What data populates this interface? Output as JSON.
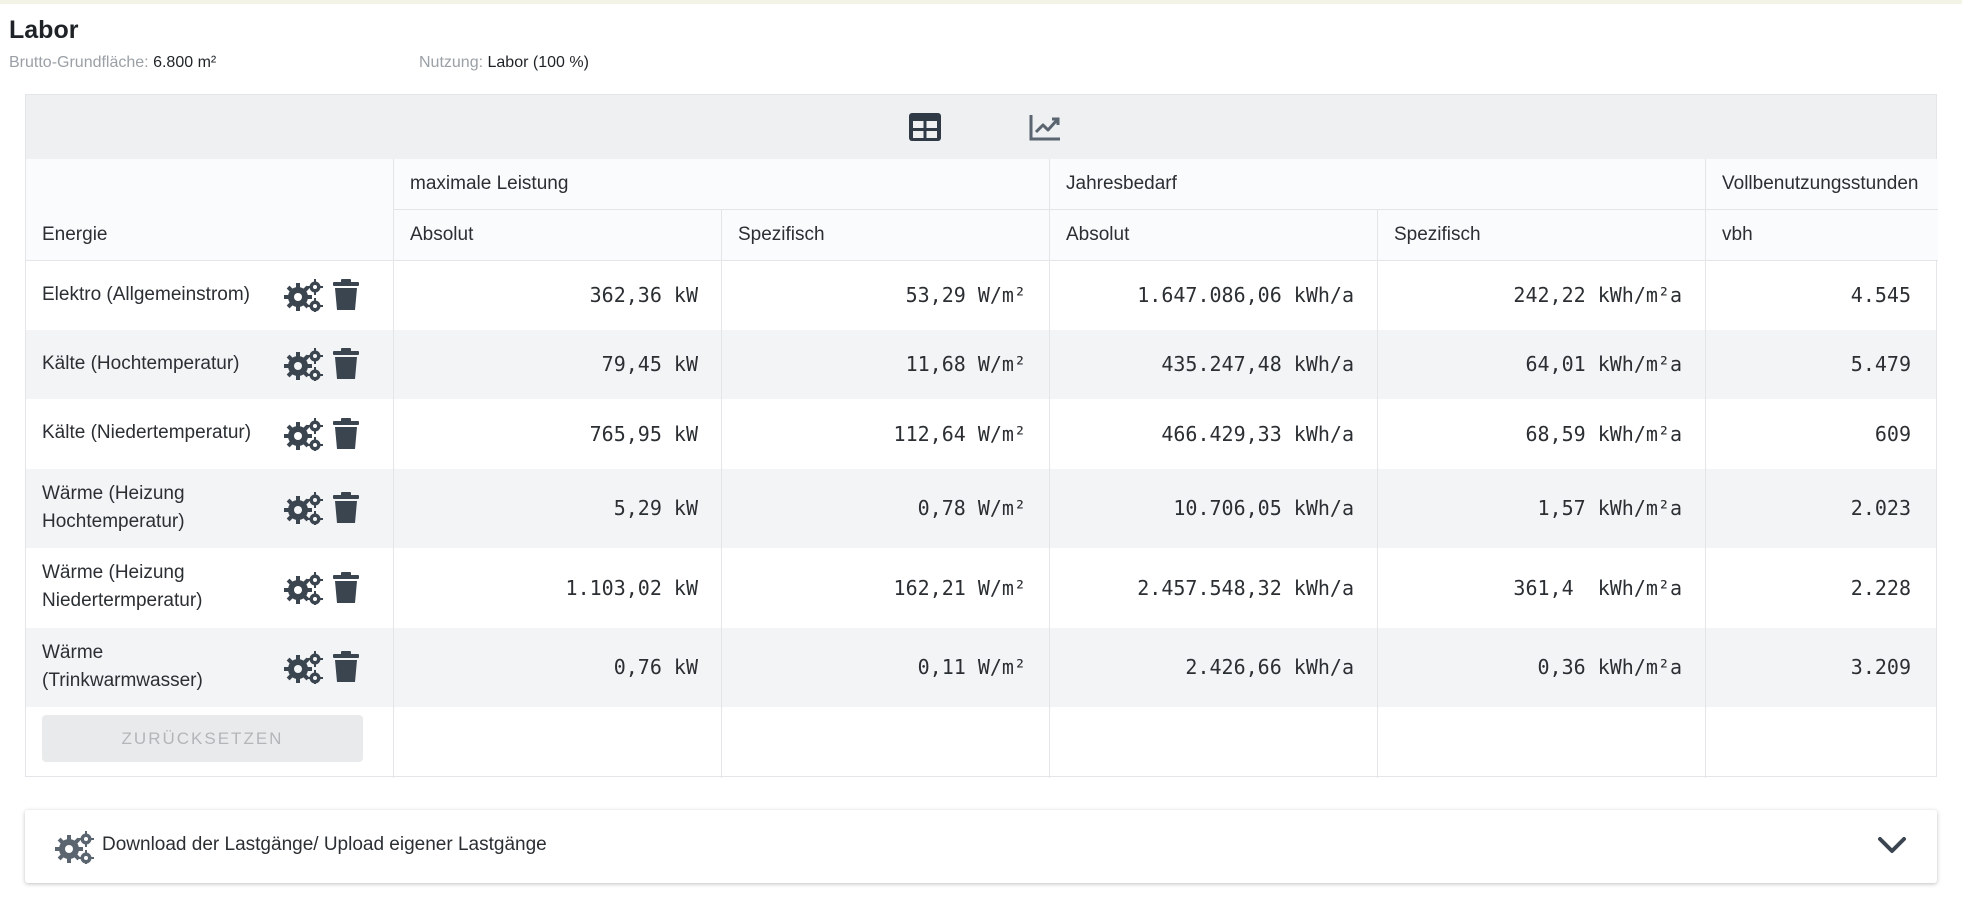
{
  "page": {
    "title": "Labor",
    "area_label": "Brutto-Grundfläche:",
    "area_value": "6.800 m²",
    "usage_label": "Nutzung:",
    "usage_value": "Labor (100 %)"
  },
  "toolbar": {
    "icons": [
      "table-icon",
      "line-chart-icon"
    ]
  },
  "table": {
    "group_headers": [
      "maximale Leistung",
      "Jahresbedarf",
      "Vollbenutzungsstunden"
    ],
    "col_energie": "Energie",
    "sub_headers": [
      "Absolut",
      "Spezifisch",
      "Absolut",
      "Spezifisch",
      "vbh"
    ],
    "rows": [
      {
        "name": "Elektro (Allgemeinstrom)",
        "max_abs": "362,36 kW",
        "max_spec": "53,29 W/m²",
        "year_abs": "1.647.086,06 kWh/a",
        "year_spec": "242,22 kWh/m²a",
        "vbh": "4.545"
      },
      {
        "name": "Kälte (Hochtemperatur)",
        "max_abs": "79,45 kW",
        "max_spec": "11,68 W/m²",
        "year_abs": "435.247,48 kWh/a",
        "year_spec": "64,01 kWh/m²a",
        "vbh": "5.479"
      },
      {
        "name": "Kälte (Niedertemperatur)",
        "max_abs": "765,95 kW",
        "max_spec": "112,64 W/m²",
        "year_abs": "466.429,33 kWh/a",
        "year_spec": "68,59 kWh/m²a",
        "vbh": "609"
      },
      {
        "name": "Wärme (Heizung Hochtemperatur)",
        "max_abs": "5,29 kW",
        "max_spec": "0,78 W/m²",
        "year_abs": "10.706,05 kWh/a",
        "year_spec": "1,57 kWh/m²a",
        "vbh": "2.023"
      },
      {
        "name": "Wärme (Heizung Niedertermperatur)",
        "max_abs": "1.103,02 kW",
        "max_spec": "162,21 W/m²",
        "year_abs": "2.457.548,32 kWh/a",
        "year_spec": "361,4  kWh/m²a",
        "vbh": "2.228"
      },
      {
        "name": "Wärme (Trinkwarmwasser)",
        "max_abs": "0,76 kW",
        "max_spec": "0,11 W/m²",
        "year_abs": "2.426,66 kWh/a",
        "year_spec": "0,36 kWh/m²a",
        "vbh": "3.209"
      }
    ],
    "reset_label": "ZURÜCKSETZEN"
  },
  "panel": {
    "label": "Download der Lastgänge/ Upload eigener Lastgänge"
  },
  "colors": {
    "icon_dark": "#3b4550",
    "accent_header": "#eef0f2"
  }
}
